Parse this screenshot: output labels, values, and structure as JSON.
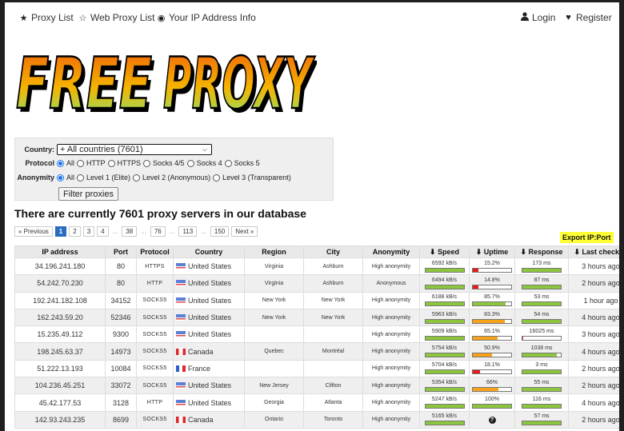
{
  "nav": {
    "left": [
      {
        "icon": "star-icon",
        "glyph": "★",
        "label": "Proxy List"
      },
      {
        "icon": "star-outline-icon",
        "glyph": "☆",
        "label": "Web Proxy List"
      },
      {
        "icon": "eye-icon",
        "glyph": "◉",
        "label": "Your IP Address Info"
      }
    ],
    "right": [
      {
        "icon": "user-icon",
        "glyph": "👤",
        "label": "Login"
      },
      {
        "icon": "heart-icon",
        "glyph": "♥",
        "label": "Register"
      }
    ]
  },
  "logo": {
    "text": "FREE PROXY",
    "colors": {
      "top": "#f05a0a",
      "mid": "#f4b400",
      "bottom": "#7de87d"
    }
  },
  "filter": {
    "country_label": "Country:",
    "country_value": "+ All countries (7601)",
    "protocol_label": "Protocol",
    "protocol_options": [
      {
        "label": "All",
        "checked": true
      },
      {
        "label": "HTTP",
        "checked": false
      },
      {
        "label": "HTTPS",
        "checked": false
      },
      {
        "label": "Socks 4/5",
        "checked": false
      },
      {
        "label": "Socks 4",
        "checked": false
      },
      {
        "label": "Socks 5",
        "checked": false
      }
    ],
    "anonymity_label": "Anonymity",
    "anonymity_options": [
      {
        "label": "All",
        "checked": true
      },
      {
        "label": "Level 1 (Elite)",
        "checked": false
      },
      {
        "label": "Level 2 (Anonymous)",
        "checked": false
      },
      {
        "label": "Level 3 (Transparent)",
        "checked": false
      }
    ],
    "button_label": "Filter proxies"
  },
  "headline": "There are currently 7601 proxy servers in our database",
  "pagination": {
    "items": [
      "« Previous",
      "1",
      "2",
      "3",
      "4",
      "...",
      "38",
      "...",
      "76",
      "...",
      "113",
      "...",
      "150",
      "Next »"
    ],
    "active": "1"
  },
  "export_label": "Export IP:Port",
  "table": {
    "columns": [
      "IP address",
      "Port",
      "Protocol",
      "Country",
      "Region",
      "City",
      "Anonymity",
      "Speed",
      "Uptime",
      "Response",
      "Last checked"
    ],
    "sortable": [
      "Speed",
      "Uptime",
      "Response",
      "Last checked"
    ],
    "rows": [
      {
        "ip": "34.196.241.180",
        "port": "80",
        "protocol": "HTTPS",
        "flag": "us",
        "country": "United States",
        "region": "Virginia",
        "city": "Ashburn",
        "anonymity": "High anonymity",
        "speed": "6592 kB/s",
        "speed_pct": 100,
        "uptime": "15.2%",
        "uptime_pct": 15.2,
        "uptime_color": "#e31c1c",
        "response": "173 ms",
        "response_pct": 100,
        "last": "3 hours ago"
      },
      {
        "ip": "54.242.70.230",
        "port": "80",
        "protocol": "HTTP",
        "flag": "us",
        "country": "United States",
        "region": "Virginia",
        "city": "Ashburn",
        "anonymity": "Anonymous",
        "speed": "6494 kB/s",
        "speed_pct": 100,
        "uptime": "14.8%",
        "uptime_pct": 14.8,
        "uptime_color": "#e31c1c",
        "response": "87 ms",
        "response_pct": 100,
        "last": "2 hours ago"
      },
      {
        "ip": "192.241.182.108",
        "port": "34152",
        "protocol": "SOCKS5",
        "flag": "us",
        "country": "United States",
        "region": "New York",
        "city": "New York",
        "anonymity": "High anonymity",
        "speed": "6188 kB/s",
        "speed_pct": 100,
        "uptime": "85.7%",
        "uptime_pct": 85.7,
        "uptime_color": "#8cc63f",
        "response": "53 ms",
        "response_pct": 100,
        "last": "1 hour ago"
      },
      {
        "ip": "162.243.59.20",
        "port": "52346",
        "protocol": "SOCKS5",
        "flag": "us",
        "country": "United States",
        "region": "New York",
        "city": "New York",
        "anonymity": "High anonymity",
        "speed": "5963 kB/s",
        "speed_pct": 100,
        "uptime": "83.3%",
        "uptime_pct": 83.3,
        "uptime_color": "#f7a21b",
        "response": "54 ms",
        "response_pct": 100,
        "last": "4 hours ago"
      },
      {
        "ip": "15.235.49.112",
        "port": "9300",
        "protocol": "SOCKS5",
        "flag": "us",
        "country": "United States",
        "region": "",
        "city": "",
        "anonymity": "High anonymity",
        "speed": "5909 kB/s",
        "speed_pct": 100,
        "uptime": "65.1%",
        "uptime_pct": 65.1,
        "uptime_color": "#f7a21b",
        "response": "16025 ms",
        "response_pct": 3,
        "response_color": "#d04040",
        "last": "3 hours ago"
      },
      {
        "ip": "198.245.63.37",
        "port": "14973",
        "protocol": "SOCKS5",
        "flag": "ca",
        "country": "Canada",
        "region": "Quebec",
        "city": "Montréal",
        "anonymity": "High anonymity",
        "speed": "5754 kB/s",
        "speed_pct": 100,
        "uptime": "50.9%",
        "uptime_pct": 50.9,
        "uptime_color": "#f7a21b",
        "response": "1038 ms",
        "response_pct": 90,
        "last": "4 hours ago"
      },
      {
        "ip": "51.222.13.193",
        "port": "10084",
        "protocol": "SOCKS5",
        "flag": "fr",
        "country": "France",
        "region": "",
        "city": "",
        "anonymity": "High anonymity",
        "speed": "5704 kB/s",
        "speed_pct": 100,
        "uptime": "18.1%",
        "uptime_pct": 18.1,
        "uptime_color": "#e31c1c",
        "response": "3 ms",
        "response_pct": 100,
        "last": "2 hours ago"
      },
      {
        "ip": "104.236.45.251",
        "port": "33072",
        "protocol": "SOCKS5",
        "flag": "us",
        "country": "United States",
        "region": "New Jersey",
        "city": "Clifton",
        "anonymity": "High anonymity",
        "speed": "5354 kB/s",
        "speed_pct": 100,
        "uptime": "66%",
        "uptime_pct": 66,
        "uptime_color": "#f7a21b",
        "response": "55 ms",
        "response_pct": 100,
        "last": "2 hours ago"
      },
      {
        "ip": "45.42.177.53",
        "port": "3128",
        "protocol": "HTTP",
        "flag": "us",
        "country": "United States",
        "region": "Georgia",
        "city": "Atlanta",
        "anonymity": "High anonymity",
        "speed": "5247 kB/s",
        "speed_pct": 100,
        "uptime": "100%",
        "uptime_pct": 100,
        "uptime_color": "#8cc63f",
        "response": "116 ms",
        "response_pct": 100,
        "last": "4 hours ago"
      },
      {
        "ip": "142.93.243.235",
        "port": "8699",
        "protocol": "SOCKS5",
        "flag": "ca",
        "country": "Canada",
        "region": "Ontario",
        "city": "Toronto",
        "anonymity": "High anonymity",
        "speed": "5165 kB/s",
        "speed_pct": 100,
        "uptime": null,
        "uptime_unknown": "?",
        "uptime_pct": null,
        "response": "57 ms",
        "response_pct": 100,
        "last": "2 hours ago"
      }
    ]
  },
  "colors": {
    "bar_green": "#8cc63f",
    "pager_active": "#2a6cc0",
    "export_bg": "#ffff33"
  }
}
